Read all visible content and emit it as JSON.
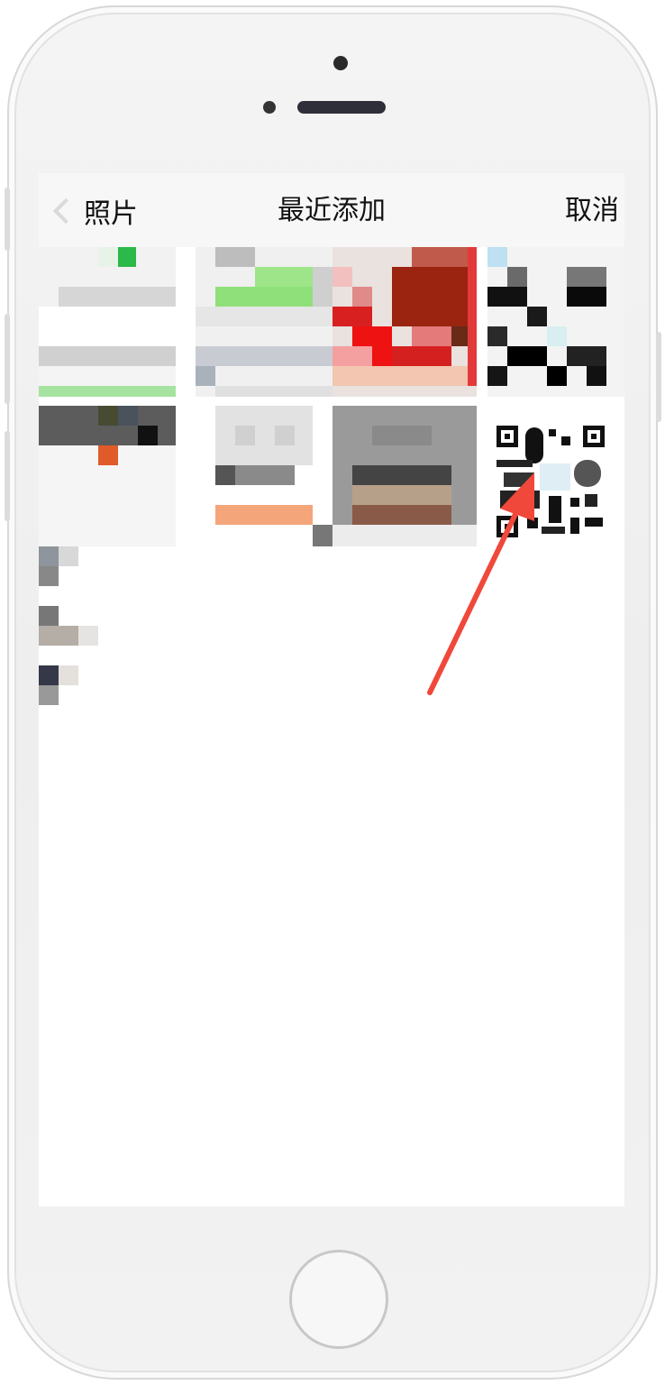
{
  "navbar": {
    "back_label": "照片",
    "title": "最近添加",
    "cancel_label": "取消"
  },
  "icons": {
    "back": "chevron-left-icon",
    "annotation": "red-arrow-icon"
  },
  "colors": {
    "annotation_arrow": "#f0483a"
  }
}
